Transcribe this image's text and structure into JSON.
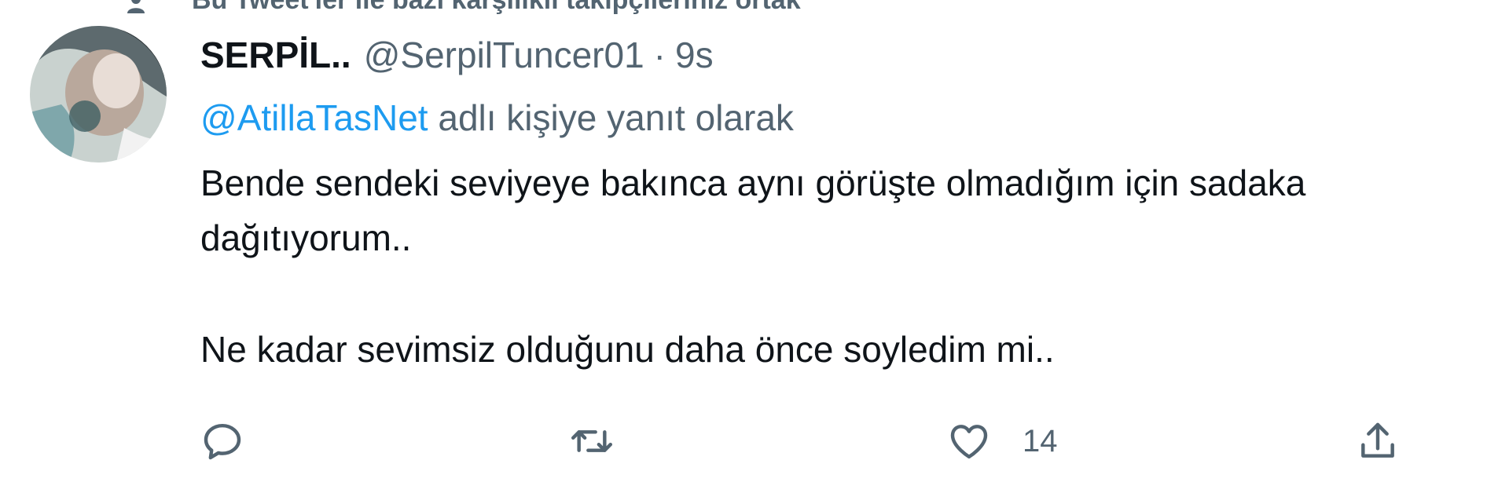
{
  "context": {
    "text": "Bu Tweet'ler ile bazı karşılıklı takipçileriniz ortak"
  },
  "tweet": {
    "name": "SERPİL..",
    "handle": "@SerpilTuncer01",
    "separator": "·",
    "time": "9s",
    "reply_mention": "@AtillaTasNet",
    "reply_suffix": " adlı kişiye yanıt olarak",
    "body_line1": "Bende sendeki seviyeye bakınca aynı görüşte olmadığım için sadaka",
    "body_line2": "dağıtıyorum..",
    "body_line3": "Ne kadar sevimsiz olduğunu daha önce soyledim mi.."
  },
  "actions": {
    "reply_icon": "reply-icon",
    "retweet_icon": "retweet-icon",
    "like_icon": "heart-icon",
    "like_count": "14",
    "share_icon": "share-icon"
  },
  "colors": {
    "text": "#0f1419",
    "secondary": "#536471",
    "link": "#1d9bf0"
  }
}
